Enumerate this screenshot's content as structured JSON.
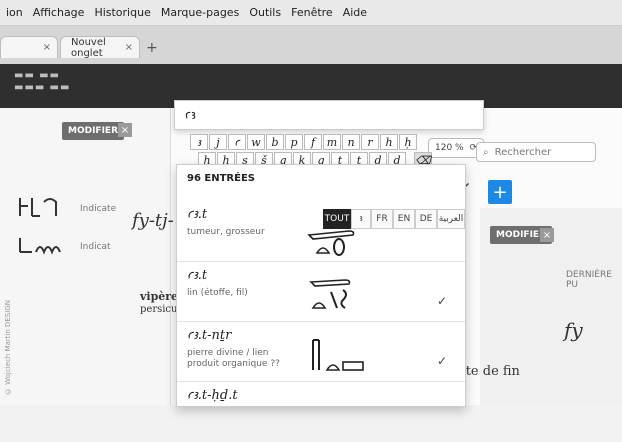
{
  "menubar": {
    "items": [
      "ion",
      "Affichage",
      "Historique",
      "Marque-pages",
      "Outils",
      "Fenêtre",
      "Aide"
    ]
  },
  "tabs": {
    "first_close": "×",
    "second_label": "Nouvel onglet",
    "second_close": "×",
    "new_tab": "+"
  },
  "toolbar": {
    "zoom": "120 %",
    "search_placeholder": "Rechercher"
  },
  "left": {
    "modifier_label": "MODIFIER",
    "close": "×",
    "small_label_1": "Indicate",
    "small_label_2": "Indicat"
  },
  "search": {
    "query": "ꜥꜣ"
  },
  "keyboard": {
    "row1": [
      "ꜣ",
      "j",
      "ꜥ",
      "w",
      "b",
      "p",
      "f",
      "m",
      "n",
      "r",
      "h",
      "ḥ"
    ],
    "row2": [
      "ḫ",
      "ẖ",
      "s",
      "š",
      "q",
      "k",
      "g",
      "t",
      "ṯ",
      "d",
      "ḏ"
    ]
  },
  "results": {
    "count_label": "96 ENTRÉES",
    "filters": [
      "TOUT",
      "ꜣ",
      "FR",
      "EN",
      "DE",
      "العربية"
    ],
    "entries": [
      {
        "translit": "ꜥꜣ.t",
        "meaning": "tumeur, grosseur",
        "checked": false
      },
      {
        "translit": "ꜥꜣ.t",
        "meaning": "lin (étoffe, fil)",
        "checked": true
      },
      {
        "translit": "ꜥꜣ.t-nṯr",
        "meaning": "pierre divine / lien produit organique ??",
        "checked": true
      },
      {
        "translit": "ꜥꜣ.t-ḥḏ.t",
        "meaning": "",
        "checked": false
      }
    ]
  },
  "background": {
    "fy_text": "fy-tj-ꜥn",
    "vipere_1": "vipère pers",
    "vipere_2": "persicus field",
    "ete_de_fin": "ête de fin",
    "fy_right": "fy",
    "modifier_right": "MODIFIER",
    "derniere": "DERNIÈRE PU"
  },
  "watermark": "© Wojciech Martin DESIGN"
}
